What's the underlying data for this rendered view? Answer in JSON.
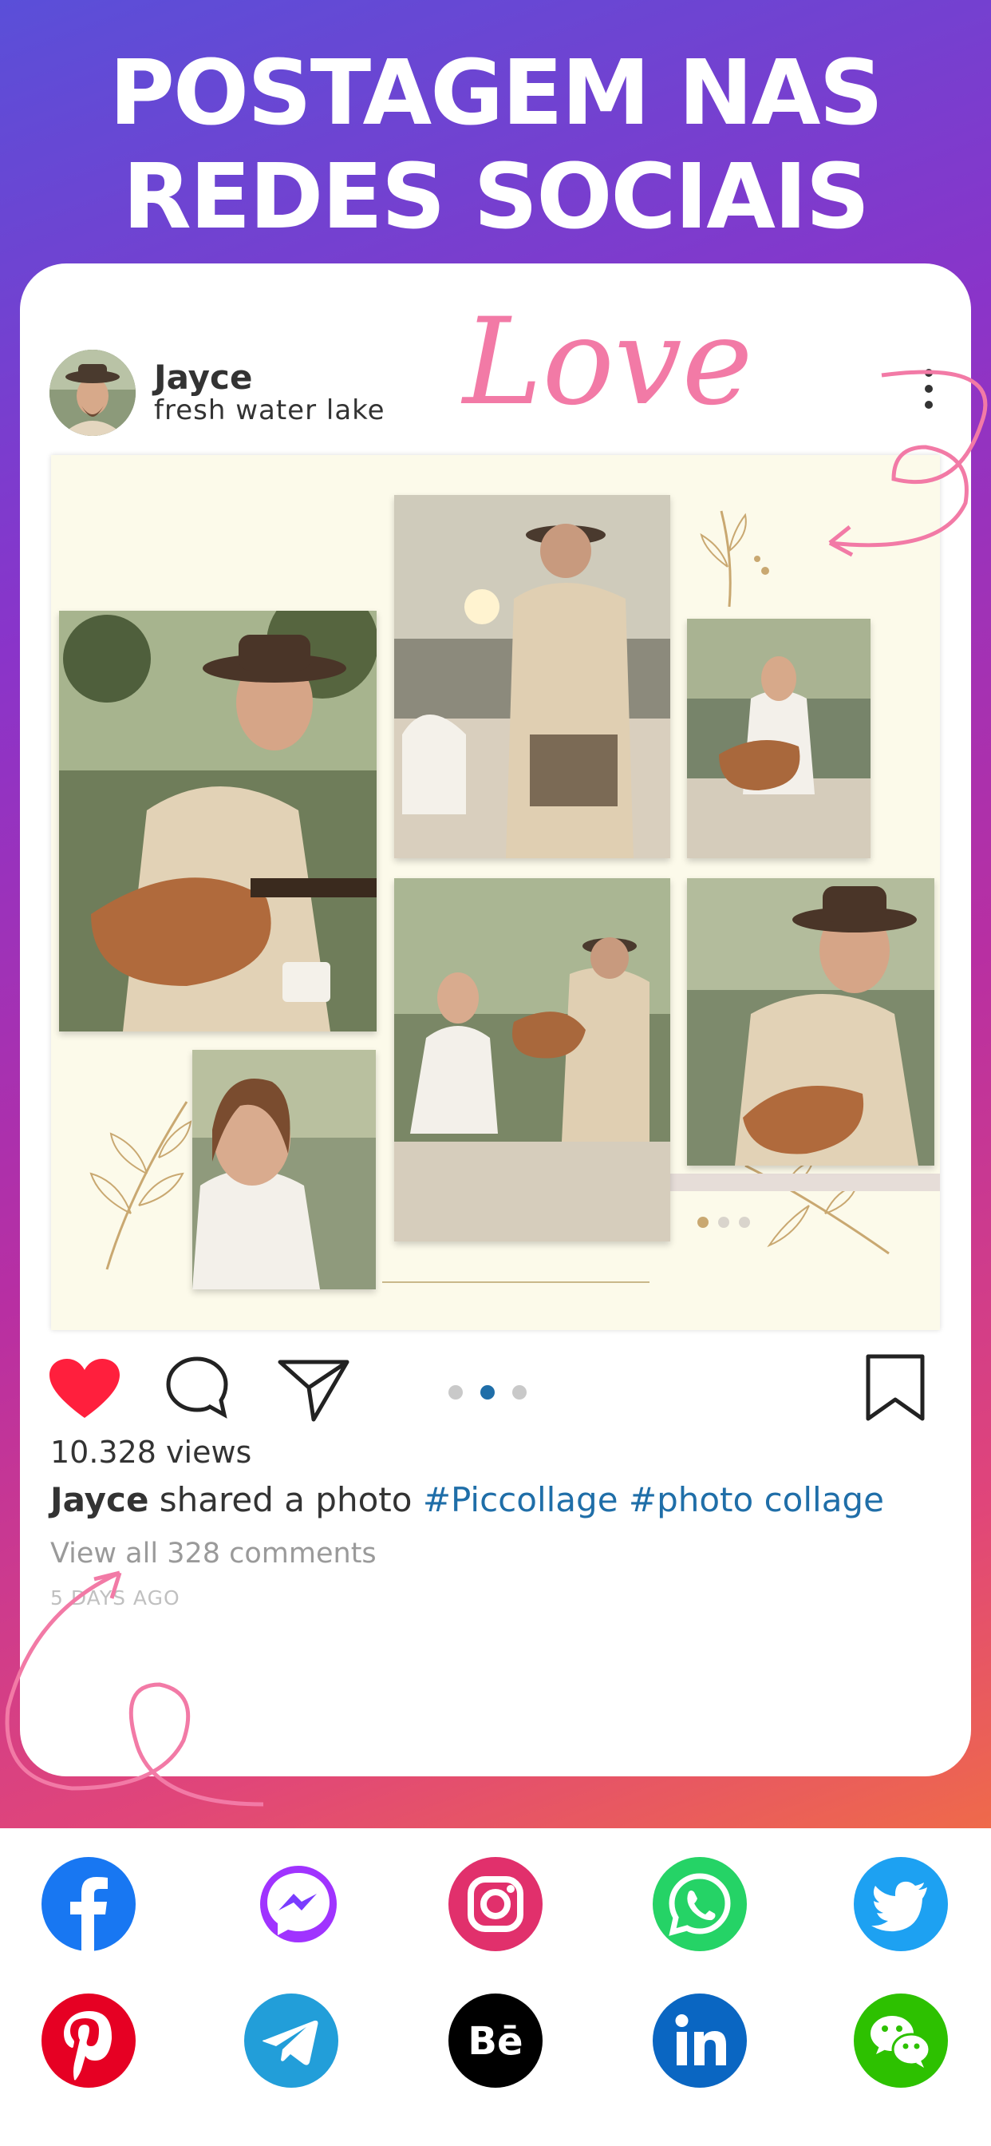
{
  "header": {
    "line1": "POSTAGEM NAS",
    "line2": "REDES SOCIAIS",
    "decor_text": "Love"
  },
  "post": {
    "username": "Jayce",
    "location": "fresh water lake",
    "views": "10.328 views",
    "caption_user": "Jayce",
    "caption_text": " shared a photo ",
    "hashtags": "#Piccollage #photo collage",
    "comments_link": "View all 328 comments",
    "timestamp": "5 DAYS AGO",
    "carousel_pages": 3,
    "carousel_active": 2,
    "liked": true
  },
  "colors": {
    "like": "#ff1f3d",
    "hashtag": "#1f6ea8",
    "active_dot": "#1f6ea8",
    "decor_pink": "#f27aa6"
  },
  "social_icons": [
    {
      "name": "facebook-icon",
      "color": "#1877f2"
    },
    {
      "name": "messenger-icon",
      "color": "#a033ff"
    },
    {
      "name": "instagram-icon",
      "color": "#e1306c"
    },
    {
      "name": "whatsapp-icon",
      "color": "#25d366"
    },
    {
      "name": "twitter-icon",
      "color": "#1da1f2"
    },
    {
      "name": "pinterest-icon",
      "color": "#e60023"
    },
    {
      "name": "telegram-icon",
      "color": "#229ed9"
    },
    {
      "name": "behance-icon",
      "color": "#000000"
    },
    {
      "name": "linkedin-icon",
      "color": "#0a66c2"
    },
    {
      "name": "wechat-icon",
      "color": "#2dc100"
    }
  ]
}
